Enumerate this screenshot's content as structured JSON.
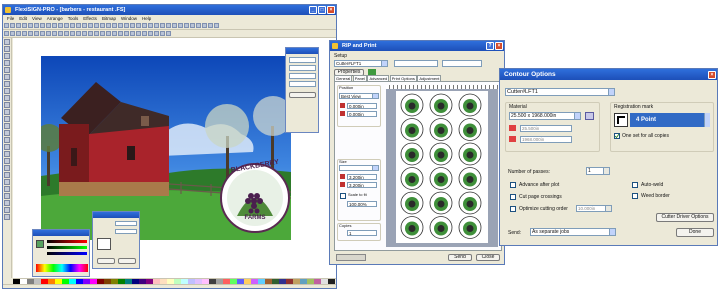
{
  "flexi_window": {
    "title": "FlexiSIGN-PRO - [barbers - restaurant .FS]",
    "menu": [
      "File",
      "Edit",
      "View",
      "Arrange",
      "Tools",
      "Effects",
      "Bitmap",
      "Window",
      "Help"
    ]
  },
  "color_palette": [
    "#000000",
    "#ffffff",
    "#7f7f7f",
    "#c0c0c0",
    "#ff0000",
    "#ff7f00",
    "#ffff00",
    "#00ff00",
    "#00ffff",
    "#0000ff",
    "#7f00ff",
    "#ff00ff",
    "#7f0000",
    "#7f3f00",
    "#7f7f00",
    "#007f00",
    "#007f7f",
    "#00007f",
    "#3f007f",
    "#7f007f",
    "#ffbfbf",
    "#ffdfbf",
    "#ffffbf",
    "#bfffbf",
    "#bfffff",
    "#bfbfff",
    "#dfbfff",
    "#ffbfff",
    "#3f3f3f",
    "#9f9f9f",
    "#ff5f5f",
    "#5fff5f",
    "#5f5fff",
    "#ffcf5f",
    "#cf5fff",
    "#5fcfff",
    "#a06030",
    "#306030",
    "#303090",
    "#903030",
    "#c0a060",
    "#60a0c0",
    "#a0c060",
    "#c060a0",
    "#e0e0e0",
    "#202020"
  ],
  "logo": {
    "top_text": "BLACKBERRY",
    "bottom_text": "FARMS"
  },
  "rip_window": {
    "title": "RIP and Print",
    "setup_label": "Setup",
    "setup_value": "Cutter#LFT1",
    "properties_button": "Properties",
    "tabs": [
      "General",
      "Panel",
      "Advanced",
      "Print Options",
      "Adjustment"
    ],
    "sections": [
      "Position",
      "Size",
      "Copies"
    ],
    "position_dropdown": "Best View",
    "scale_label": "Scale to fit",
    "scale_value": "100.00%",
    "copies_value": "1",
    "x_value": "0.000in",
    "y_value": "0.000in",
    "w_value": "3.200in",
    "h_value": "3.200in",
    "ok_button": "Send",
    "close_button": "Close"
  },
  "contour_window": {
    "title": "Contour Options",
    "cutter": "Cutter#LFT1",
    "material_group": "Material",
    "material_value": "25.500 x 1968.000in",
    "material_dim1": "25.500in",
    "material_dim2": "1968.000in",
    "registration_group": "Registration mark",
    "registration_value": "4 Point",
    "one_set_label": "One set for all copies",
    "passes_label": "Number of passes:",
    "passes_value": "1",
    "advance_label": "Advance after plot",
    "crossings_label": "Cut page crossings",
    "optimize_label": "Optimize cutting order",
    "optimize_value": "10.000in",
    "autoweld_label": "Auto-weld",
    "weed_label": "Weed border",
    "cutter_driver_button": "Cutter Driver Options",
    "done_button": "Done",
    "send_label": "Send:",
    "send_value": "As separate jobs"
  }
}
